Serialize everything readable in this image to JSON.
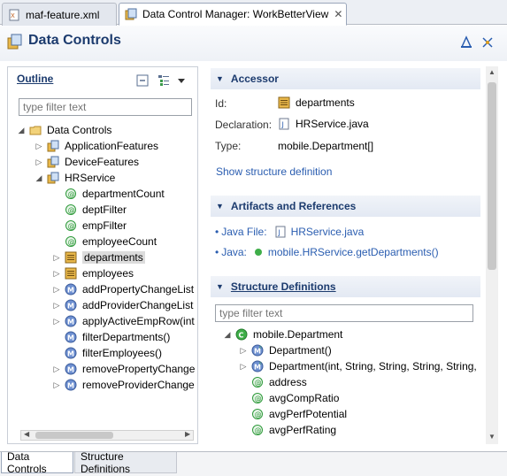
{
  "tabs": [
    {
      "label": "maf-feature.xml",
      "icon": "xml-file-icon"
    },
    {
      "label": "Data Control Manager: WorkBetterView",
      "icon": "data-control-icon",
      "close": "✕"
    }
  ],
  "header": {
    "title": "Data Controls"
  },
  "outline": {
    "title": "Outline",
    "filter_placeholder": "type filter text",
    "items": [
      {
        "label": "Data Controls",
        "icon": "folder-icon",
        "expander": "◢"
      },
      {
        "label": "ApplicationFeatures",
        "icon": "data-control-icon",
        "expander": "▷"
      },
      {
        "label": "DeviceFeatures",
        "icon": "data-control-icon",
        "expander": "▷"
      },
      {
        "label": "HRService",
        "icon": "data-control-icon",
        "expander": "◢"
      },
      {
        "label": "departmentCount",
        "icon": "attribute-icon"
      },
      {
        "label": "deptFilter",
        "icon": "attribute-icon"
      },
      {
        "label": "empFilter",
        "icon": "attribute-icon"
      },
      {
        "label": "employeeCount",
        "icon": "attribute-icon"
      },
      {
        "label": "departments",
        "icon": "collection-icon",
        "expander": "▷",
        "selected": true
      },
      {
        "label": "employees",
        "icon": "collection-icon",
        "expander": "▷"
      },
      {
        "label": "addPropertyChangeList",
        "icon": "method-icon",
        "expander": "▷"
      },
      {
        "label": "addProviderChangeList",
        "icon": "method-icon",
        "expander": "▷"
      },
      {
        "label": "applyActiveEmpRow(int",
        "icon": "method-icon",
        "expander": "▷"
      },
      {
        "label": "filterDepartments()",
        "icon": "method-icon"
      },
      {
        "label": "filterEmployees()",
        "icon": "method-icon"
      },
      {
        "label": "removePropertyChange",
        "icon": "method-icon",
        "expander": "▷"
      },
      {
        "label": "removeProviderChange",
        "icon": "method-icon",
        "expander": "▷"
      }
    ]
  },
  "accessor": {
    "title": "Accessor",
    "id_label": "Id:",
    "id_value": "departments",
    "declaration_label": "Declaration:",
    "declaration_value": "HRService.java",
    "type_label": "Type:",
    "type_value": "mobile.Department[]",
    "show_structure_link": "Show structure definition"
  },
  "artifacts": {
    "title": "Artifacts and References",
    "java_file_label": "Java File:",
    "java_file_value": "HRService.java",
    "java_label": "Java:",
    "java_value": "mobile.HRService.getDepartments()"
  },
  "structure": {
    "title": "Structure Definitions",
    "filter_placeholder": "type filter text",
    "items": [
      {
        "label": "mobile.Department",
        "icon": "class-icon",
        "expander": "◢"
      },
      {
        "label": "Department()",
        "icon": "constructor-icon",
        "expander": "▷"
      },
      {
        "label": "Department(int, String, String, String, String,",
        "icon": "constructor-icon",
        "expander": "▷"
      },
      {
        "label": "address",
        "icon": "attribute-icon"
      },
      {
        "label": "avgCompRatio",
        "icon": "attribute-icon"
      },
      {
        "label": "avgPerfPotential",
        "icon": "attribute-icon"
      },
      {
        "label": "avgPerfRating",
        "icon": "attribute-icon"
      }
    ]
  },
  "bottom_tabs": [
    "Data Controls",
    "Structure Definitions"
  ],
  "colors": {
    "header_text": "#1c3b6e",
    "link": "#2a5db0",
    "attribute_green": "#2e9a3a",
    "method_blue": "#5b7fc0"
  }
}
